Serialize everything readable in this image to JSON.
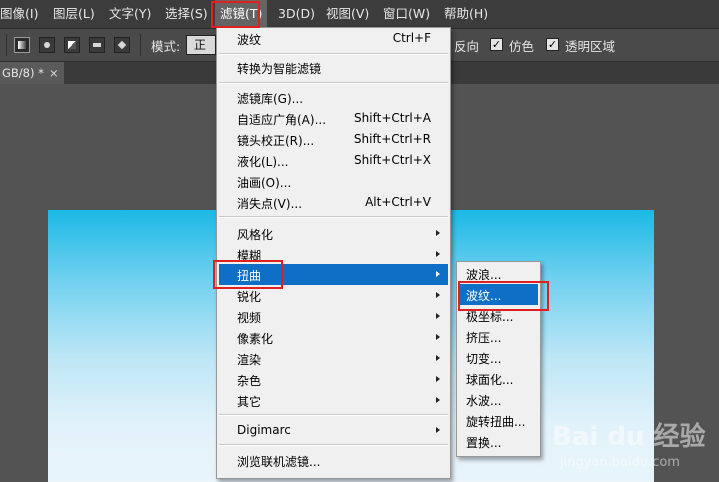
{
  "menubar": {
    "items": [
      {
        "label": "图像(I)"
      },
      {
        "label": "图层(L)"
      },
      {
        "label": "文字(Y)"
      },
      {
        "label": "选择(S)"
      },
      {
        "label": "滤镜(T)"
      },
      {
        "label": "3D(D)"
      },
      {
        "label": "视图(V)"
      },
      {
        "label": "窗口(W)"
      },
      {
        "label": "帮助(H)"
      }
    ]
  },
  "options_bar": {
    "mode_label": "模式:",
    "mode_value": "正常",
    "reverse_label": "反向",
    "dither_label": "仿色",
    "transparency_label": "透明区域",
    "check_mark": "✓"
  },
  "document_tab": {
    "title": "GB/8) *",
    "close": "×"
  },
  "filter_menu": {
    "items": [
      {
        "label": "波纹",
        "shortcut": "Ctrl+F"
      },
      {
        "label": "转换为智能滤镜",
        "shortcut": ""
      },
      {
        "label": "滤镜库(G)...",
        "shortcut": ""
      },
      {
        "label": "自适应广角(A)...",
        "shortcut": "Shift+Ctrl+A"
      },
      {
        "label": "镜头校正(R)...",
        "shortcut": "Shift+Ctrl+R"
      },
      {
        "label": "液化(L)...",
        "shortcut": "Shift+Ctrl+X"
      },
      {
        "label": "油画(O)...",
        "shortcut": ""
      },
      {
        "label": "消失点(V)...",
        "shortcut": "Alt+Ctrl+V"
      },
      {
        "label": "风格化",
        "shortcut": ""
      },
      {
        "label": "模糊",
        "shortcut": ""
      },
      {
        "label": "扭曲",
        "shortcut": ""
      },
      {
        "label": "锐化",
        "shortcut": ""
      },
      {
        "label": "视频",
        "shortcut": ""
      },
      {
        "label": "像素化",
        "shortcut": ""
      },
      {
        "label": "渲染",
        "shortcut": ""
      },
      {
        "label": "杂色",
        "shortcut": ""
      },
      {
        "label": "其它",
        "shortcut": ""
      },
      {
        "label": "Digimarc",
        "shortcut": ""
      },
      {
        "label": "浏览联机滤镜...",
        "shortcut": ""
      }
    ]
  },
  "distort_submenu": {
    "items": [
      {
        "label": "波浪..."
      },
      {
        "label": "波纹..."
      },
      {
        "label": "极坐标..."
      },
      {
        "label": "挤压..."
      },
      {
        "label": "切变..."
      },
      {
        "label": "球面化..."
      },
      {
        "label": "水波..."
      },
      {
        "label": "旋转扭曲..."
      },
      {
        "label": "置换..."
      }
    ]
  },
  "watermark": {
    "brand": "Bai du 经验",
    "url": "jingyan.baidu.com"
  },
  "colors": {
    "highlight": "#0f6fc6",
    "annotation_red": "#e02020"
  }
}
